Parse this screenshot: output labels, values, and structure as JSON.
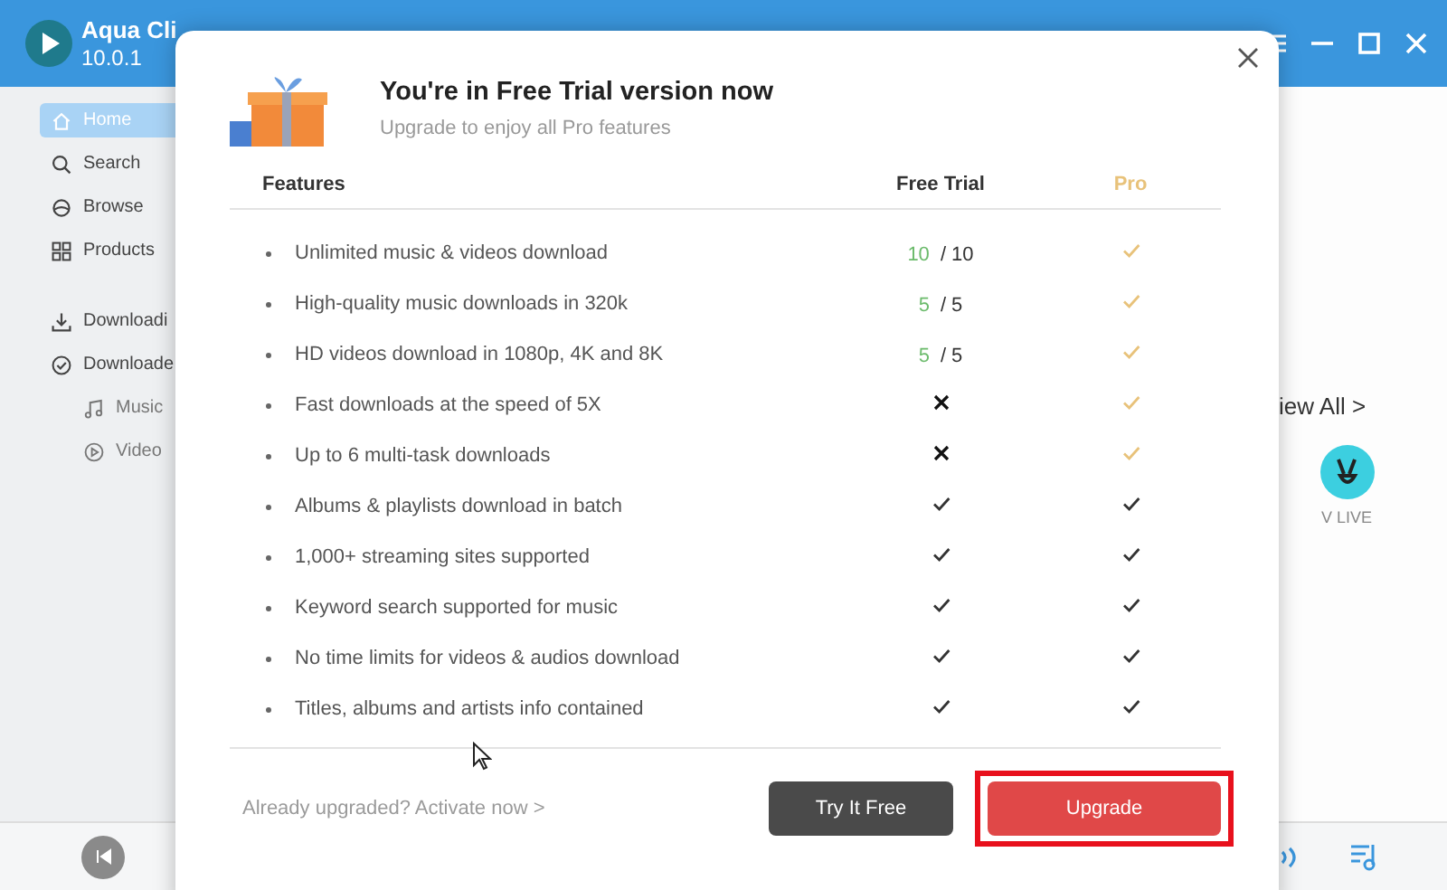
{
  "app": {
    "name": "Aqua Cli",
    "version": "10.0.1"
  },
  "sidebar": {
    "sections": [
      {
        "items": [
          {
            "label": "Home",
            "kind": "main",
            "selected": true
          },
          {
            "label": "Search",
            "kind": "main",
            "selected": false
          },
          {
            "label": "Browse",
            "kind": "main",
            "selected": false
          },
          {
            "label": "Products",
            "kind": "main",
            "selected": false
          }
        ]
      },
      {
        "items": [
          {
            "label": "Downloadi",
            "kind": "main",
            "selected": false
          },
          {
            "label": "Downloade",
            "kind": "main",
            "selected": false
          },
          {
            "label": "Music",
            "kind": "sub",
            "selected": false
          },
          {
            "label": "Video",
            "kind": "sub",
            "selected": false
          }
        ]
      }
    ]
  },
  "main": {
    "view_all": "iew All >",
    "site": {
      "label": "V LIVE"
    }
  },
  "dialog": {
    "title": "You're in Free Trial version now",
    "subtitle": "Upgrade to enjoy all Pro features",
    "columns": [
      "Features",
      "Free Trial",
      "Pro"
    ],
    "rows": [
      {
        "feature": "Unlimited music & videos download",
        "free": {
          "kind": "count",
          "used": "10",
          "rest": "/ 10"
        },
        "pro": {
          "kind": "check",
          "color": "#e8c27a"
        }
      },
      {
        "feature": "High-quality music downloads in 320k",
        "free": {
          "kind": "count",
          "used": "5",
          "rest": "/ 5"
        },
        "pro": {
          "kind": "check",
          "color": "#e8c27a"
        }
      },
      {
        "feature": "HD videos download in 1080p, 4K and 8K",
        "free": {
          "kind": "count",
          "used": "5",
          "rest": "/ 5"
        },
        "pro": {
          "kind": "check",
          "color": "#e8c27a"
        }
      },
      {
        "feature": "Fast downloads at the speed of 5X",
        "free": {
          "kind": "cross"
        },
        "pro": {
          "kind": "check",
          "color": "#e8c27a"
        }
      },
      {
        "feature": "Up to 6 multi-task downloads",
        "free": {
          "kind": "cross"
        },
        "pro": {
          "kind": "check",
          "color": "#e8c27a"
        }
      },
      {
        "feature": "Albums & playlists download in batch",
        "free": {
          "kind": "check"
        },
        "pro": {
          "kind": "check",
          "color": "#333333"
        }
      },
      {
        "feature": "1,000+ streaming sites supported",
        "free": {
          "kind": "check"
        },
        "pro": {
          "kind": "check",
          "color": "#333333"
        }
      },
      {
        "feature": "Keyword search supported for music",
        "free": {
          "kind": "check"
        },
        "pro": {
          "kind": "check",
          "color": "#333333"
        }
      },
      {
        "feature": "No time limits for videos & audios download",
        "free": {
          "kind": "check"
        },
        "pro": {
          "kind": "check",
          "color": "#333333"
        }
      },
      {
        "feature": "Titles, albums and artists info contained",
        "free": {
          "kind": "check"
        },
        "pro": {
          "kind": "check",
          "color": "#333333"
        }
      }
    ],
    "activate_link": "Already upgraded? Activate now >",
    "buttons": [
      {
        "label": "Try It Free",
        "kind": "secondary",
        "highlighted": false
      },
      {
        "label": "Upgrade",
        "kind": "primary",
        "highlighted": true
      }
    ]
  }
}
